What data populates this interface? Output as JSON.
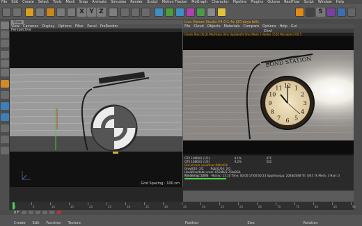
{
  "menu": [
    "File",
    "Edit",
    "Create",
    "Select",
    "Tools",
    "Mesh",
    "Snap",
    "Animate",
    "Simulate",
    "Render",
    "Sculpt",
    "Motion Tracker",
    "MoGraph",
    "Character",
    "Pipeline",
    "Plugins",
    "Octane",
    "RealFlow",
    "Script",
    "Window",
    "Help"
  ],
  "toolbar": {
    "x": "X",
    "y": "Y",
    "z": "Z",
    "s": "S"
  },
  "viewport": {
    "tabs": [
      "View",
      "Cameras",
      "Display",
      "Options",
      "Filter",
      "Panel",
      "ProRender"
    ],
    "title": "Perspective",
    "grid_spacing": "Grid Spacing : 100 cm"
  },
  "live_viewer": {
    "title": "Live Viewer Studio V4.0-1.4v (20 days left)",
    "menus": [
      "File",
      "Cloud",
      "Objects",
      "Materials",
      "Compare",
      "Options",
      "Help",
      "Gui"
    ],
    "mode": "Chnl",
    "status_line": "Check files Ok(2) MeshGen 0ms Update(0) 0ms Mesh 1 Nodes 1510 Movable 0:00.5",
    "gpu1": "GTX 1080(0) (1/3)",
    "gpu2": "GTX 1080(0) (1/3)",
    "gpu1_vals": [
      "9.1%",
      "47C"
    ],
    "gpu2_vals": [
      "9.2%",
      "53C"
    ],
    "out_of_core": "Out-of-core used/max:0Kb/4Gb",
    "vram": "Grey8/16: 2/2",
    "rgb": "Rgb32/64: 2/0",
    "used_free": "Used/free/total vram: 653Mb/3.7Gb/8Gb",
    "rendering": "Rendering: 100%",
    "render_stats": "Ms/sec: 13.10  Time: 00:00:17/00:00:23  Spp/maxspp: 2048/2048  Tri: 0/47.7k  Mesh: 3  Hair: 0",
    "sign_text": "BOND STATION"
  },
  "clock_face": [
    "12",
    "1",
    "2",
    "3",
    "4",
    "5",
    "6",
    "7",
    "8",
    "9",
    "10",
    "11"
  ],
  "timeline": {
    "start": "0 F",
    "marks": [
      "0",
      "5",
      "10",
      "15",
      "20",
      "25",
      "30",
      "35",
      "40",
      "45",
      "50",
      "55",
      "60",
      "65",
      "70",
      "75",
      "80",
      "85",
      "90"
    ]
  },
  "bottom": {
    "tabs": [
      "Create",
      "Edit",
      "Function",
      "Texture"
    ],
    "attr_labels": [
      "Position",
      "Size",
      "Rotation"
    ],
    "frame": "0 F"
  },
  "colors": {
    "accent": "#f0a000",
    "timeline_green": "#4fd34f"
  }
}
